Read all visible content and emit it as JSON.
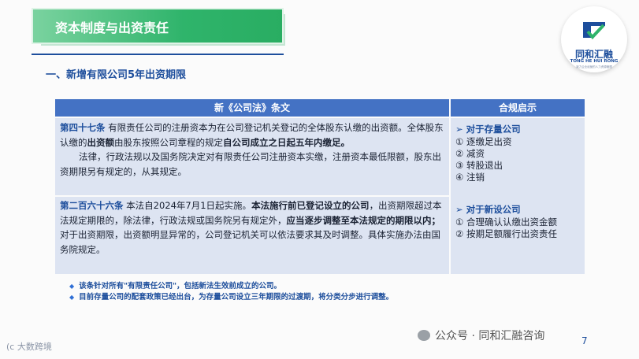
{
  "title": "资本制度与出资责任",
  "section_heading": "一、新增有限公司5年出资期限",
  "logo": {
    "cn": "同和汇融",
    "en": "TONG HE HUI RONG",
    "sub": "致力企业经营的人力资源管理"
  },
  "table": {
    "header_law": "新《公司法》条文",
    "header_hint": "合规启示",
    "law1": {
      "article": "第四十七条",
      "p1a": "有限责任公司的注册资本为在公司登记机关登记的全体股东认缴的出资额。全体股东认缴的",
      "p1b": "出资额",
      "p1c": "由股东按照公司章程的规定",
      "p1d": "自公司成立之日起五年内缴足。",
      "p2": "法律，行政法规以及国务院决定对有限责任公司注册资本实缴，注册资本最低限额，股东出资期限另有规定的，从其规定。"
    },
    "law2": {
      "article": "第二百六十六条",
      "t1": "本法自2024年7月1日起实施。",
      "t2": "本法施行前已登记设立的公司",
      "t3": "，出资期限超过本法规定期限的，除法律，行政法规或国务院另有规定外，",
      "t4": "应当逐步调整至本法规定的期限以内；",
      "t5": "对于出资期限，出资额明显异常的，公司登记机关可以依法要求其及时调整。具体实施办法由国务院规定。"
    },
    "hint1": {
      "head": "➢ 对于存量公司",
      "items": [
        "① 逐缴足出资",
        "② 减资",
        "③ 转股退出",
        "④ 注销"
      ]
    },
    "hint2": {
      "head": "➢ 对于新设公司",
      "items": [
        "① 合理确认认缴出资金额",
        "② 按期足额履行出资责任"
      ]
    }
  },
  "notes": [
    "该条针对所有\"有限责任公司\"，包括新法生效前成立的公司。",
    "目前存量公司的配套政策已经出台，为存量公司设立三年期限的过渡期，将分类分步进行调整。"
  ],
  "watermark": "公众号 · 同和汇融咨询",
  "page_number": "7",
  "corner_text": "(c 大数跨境"
}
